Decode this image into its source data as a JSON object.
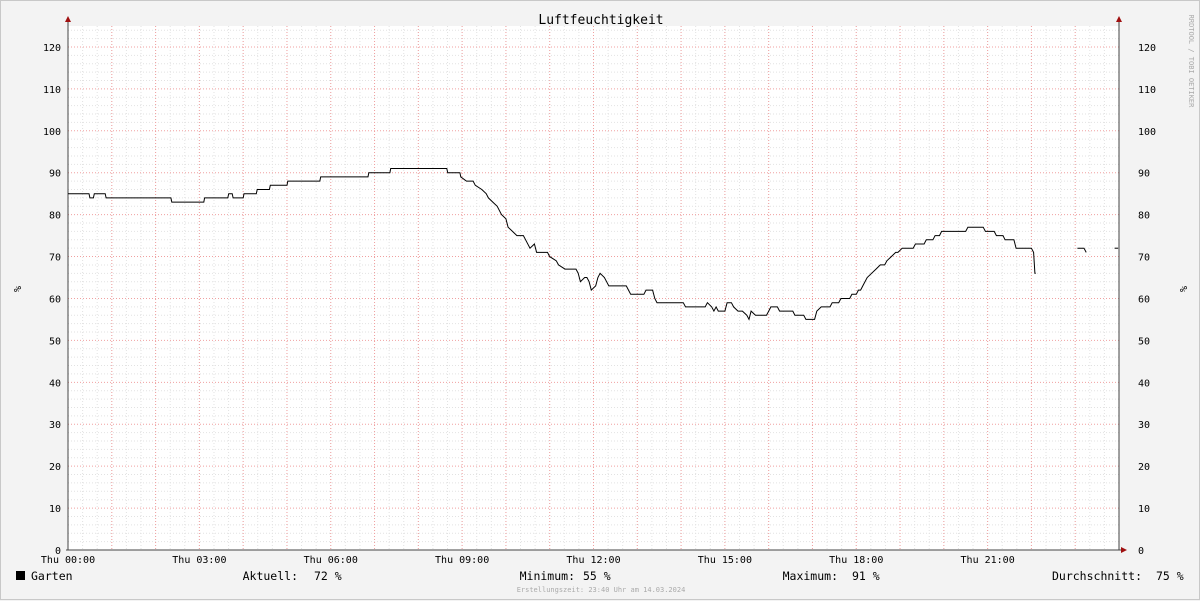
{
  "chart_data": {
    "type": "line",
    "title": "Luftfeuchtigkeit",
    "ylabel": "%",
    "ylabel_right": "%",
    "ylim": [
      0,
      125
    ],
    "yticks": [
      "0",
      "10",
      "20",
      "30",
      "40",
      "50",
      "60",
      "70",
      "80",
      "90",
      "100",
      "110",
      "120"
    ],
    "xlim": [
      0,
      24
    ],
    "xticks": [
      {
        "x": 0,
        "label": "Thu 00:00"
      },
      {
        "x": 3,
        "label": "Thu 03:00"
      },
      {
        "x": 6,
        "label": "Thu 06:00"
      },
      {
        "x": 9,
        "label": "Thu 09:00"
      },
      {
        "x": 12,
        "label": "Thu 12:00"
      },
      {
        "x": 15,
        "label": "Thu 15:00"
      },
      {
        "x": 18,
        "label": "Thu 18:00"
      },
      {
        "x": 21,
        "label": "Thu 21:00"
      }
    ],
    "grid": true,
    "series": [
      {
        "name": "Garten",
        "color": "#000000",
        "segments": [
          [
            [
              0.0,
              85
            ],
            [
              0.48,
              85
            ],
            [
              0.5,
              84
            ],
            [
              0.58,
              84
            ],
            [
              0.6,
              85
            ],
            [
              0.85,
              85
            ],
            [
              0.87,
              84
            ],
            [
              2.35,
              84
            ],
            [
              2.37,
              83
            ],
            [
              3.1,
              83
            ],
            [
              3.12,
              84
            ],
            [
              3.65,
              84
            ],
            [
              3.67,
              85
            ],
            [
              3.75,
              85
            ],
            [
              3.77,
              84
            ],
            [
              4.0,
              84
            ],
            [
              4.02,
              85
            ],
            [
              4.3,
              85
            ],
            [
              4.32,
              86
            ],
            [
              4.6,
              86
            ],
            [
              4.62,
              87
            ],
            [
              5.0,
              87
            ],
            [
              5.02,
              88
            ],
            [
              5.75,
              88
            ],
            [
              5.77,
              89
            ],
            [
              6.85,
              89
            ],
            [
              6.87,
              90
            ],
            [
              7.35,
              90
            ],
            [
              7.37,
              91
            ],
            [
              8.65,
              91
            ],
            [
              8.67,
              90
            ],
            [
              8.95,
              90
            ],
            [
              8.97,
              89
            ],
            [
              9.1,
              88
            ],
            [
              9.25,
              88
            ],
            [
              9.3,
              87
            ],
            [
              9.45,
              86
            ],
            [
              9.55,
              85
            ],
            [
              9.6,
              84
            ],
            [
              9.7,
              83
            ],
            [
              9.8,
              82
            ],
            [
              9.9,
              80
            ],
            [
              10.0,
              79
            ],
            [
              10.05,
              77
            ],
            [
              10.15,
              76
            ],
            [
              10.25,
              75
            ],
            [
              10.4,
              75
            ],
            [
              10.45,
              74
            ],
            [
              10.55,
              72
            ],
            [
              10.65,
              73
            ],
            [
              10.7,
              71
            ],
            [
              10.95,
              71
            ],
            [
              11.0,
              70
            ],
            [
              11.15,
              69
            ],
            [
              11.2,
              68
            ],
            [
              11.35,
              67
            ],
            [
              11.6,
              67
            ],
            [
              11.65,
              66
            ],
            [
              11.7,
              64
            ],
            [
              11.8,
              65
            ],
            [
              11.85,
              65
            ],
            [
              11.9,
              64
            ],
            [
              11.95,
              62
            ],
            [
              12.05,
              63
            ],
            [
              12.1,
              65
            ],
            [
              12.15,
              66
            ],
            [
              12.25,
              65
            ],
            [
              12.3,
              64
            ],
            [
              12.35,
              63
            ],
            [
              12.75,
              63
            ],
            [
              12.8,
              62
            ],
            [
              12.85,
              61
            ],
            [
              13.15,
              61
            ],
            [
              13.2,
              62
            ],
            [
              13.35,
              62
            ],
            [
              13.4,
              60
            ],
            [
              13.45,
              59
            ],
            [
              14.05,
              59
            ],
            [
              14.1,
              58
            ],
            [
              14.55,
              58
            ],
            [
              14.6,
              59
            ],
            [
              14.7,
              58
            ],
            [
              14.75,
              57
            ],
            [
              14.8,
              58
            ],
            [
              14.85,
              57
            ],
            [
              15.0,
              57
            ],
            [
              15.05,
              59
            ],
            [
              15.15,
              59
            ],
            [
              15.2,
              58
            ],
            [
              15.3,
              57
            ],
            [
              15.4,
              57
            ],
            [
              15.5,
              56
            ],
            [
              15.55,
              55
            ],
            [
              15.6,
              57
            ],
            [
              15.7,
              56
            ],
            [
              15.95,
              56
            ],
            [
              16.0,
              57
            ],
            [
              16.05,
              58
            ],
            [
              16.2,
              58
            ],
            [
              16.25,
              57
            ],
            [
              16.55,
              57
            ],
            [
              16.6,
              56
            ],
            [
              16.8,
              56
            ],
            [
              16.85,
              55
            ],
            [
              17.05,
              55
            ],
            [
              17.1,
              57
            ],
            [
              17.2,
              58
            ],
            [
              17.4,
              58
            ],
            [
              17.45,
              59
            ],
            [
              17.6,
              59
            ],
            [
              17.65,
              60
            ],
            [
              17.85,
              60
            ],
            [
              17.9,
              61
            ],
            [
              18.0,
              61
            ],
            [
              18.05,
              62
            ],
            [
              18.1,
              62
            ],
            [
              18.15,
              63
            ],
            [
              18.25,
              65
            ],
            [
              18.35,
              66
            ],
            [
              18.45,
              67
            ],
            [
              18.55,
              68
            ],
            [
              18.65,
              68
            ],
            [
              18.7,
              69
            ],
            [
              18.8,
              70
            ],
            [
              18.9,
              71
            ],
            [
              18.95,
              71
            ],
            [
              19.05,
              72
            ],
            [
              19.3,
              72
            ],
            [
              19.35,
              73
            ],
            [
              19.55,
              73
            ],
            [
              19.6,
              74
            ],
            [
              19.75,
              74
            ],
            [
              19.8,
              75
            ],
            [
              19.9,
              75
            ],
            [
              19.95,
              76
            ],
            [
              20.5,
              76
            ],
            [
              20.55,
              77
            ],
            [
              20.9,
              77
            ],
            [
              20.95,
              76
            ],
            [
              21.15,
              76
            ],
            [
              21.2,
              75
            ],
            [
              21.35,
              75
            ],
            [
              21.4,
              74
            ],
            [
              21.6,
              74
            ],
            [
              21.65,
              72
            ],
            [
              22.0,
              72
            ],
            [
              22.05,
              71
            ],
            [
              22.08,
              66
            ],
            [
              22.1,
              66
            ]
          ],
          [
            [
              23.05,
              72
            ],
            [
              23.2,
              72
            ],
            [
              23.25,
              71
            ]
          ],
          [
            [
              23.9,
              72
            ],
            [
              23.98,
              72
            ]
          ]
        ]
      }
    ]
  },
  "legend": {
    "series_name": "Garten",
    "current_label": "Aktuell:",
    "current_value": "72 %",
    "min_label": "Minimum:",
    "min_value": "55 %",
    "max_label": "Maximum:",
    "max_value": "91 %",
    "avg_label": "Durchschnitt:",
    "avg_value": "75 %"
  },
  "footer": "Erstellungszeit: 23:40 Uhr am 14.03.2024",
  "watermark": "RRDTOOL / TOBI OETIKER"
}
